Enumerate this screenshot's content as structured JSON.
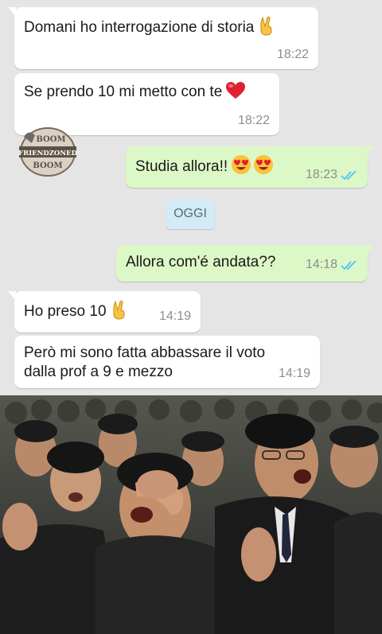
{
  "messages": [
    {
      "text": "Domani ho interrogazione di storia",
      "time": "18:22",
      "emoji": "victory-hand"
    },
    {
      "text": "Se prendo 10 mi metto con te",
      "time": "18:22",
      "emoji": "red-heart"
    },
    {
      "text": "Studia allora!!",
      "time": "18:23",
      "emoji": "heart-eyes-face-x2",
      "status": "read"
    },
    {
      "text": "Allora com'é andata??",
      "time": "14:18",
      "status": "read"
    },
    {
      "text": "Ho preso 10",
      "time": "14:19",
      "emoji": "victory-hand"
    },
    {
      "line1": "Però mi sono fatta abbassare il voto",
      "line2": "dalla prof a 9 e mezzo",
      "time": "14:19"
    }
  ],
  "day_separator": "OGGI",
  "watermark": {
    "top": "BOOM",
    "middle": "FRIENDZONED",
    "bottom": "BOOM"
  },
  "colors": {
    "background": "#e5e5e5",
    "incoming_bubble": "#ffffff",
    "outgoing_bubble": "#dcf8c6",
    "read_ticks": "#4fc3f7",
    "day_pill": "#d4eaf4"
  },
  "photo": {
    "subject": "crowd-of-crying-people"
  }
}
